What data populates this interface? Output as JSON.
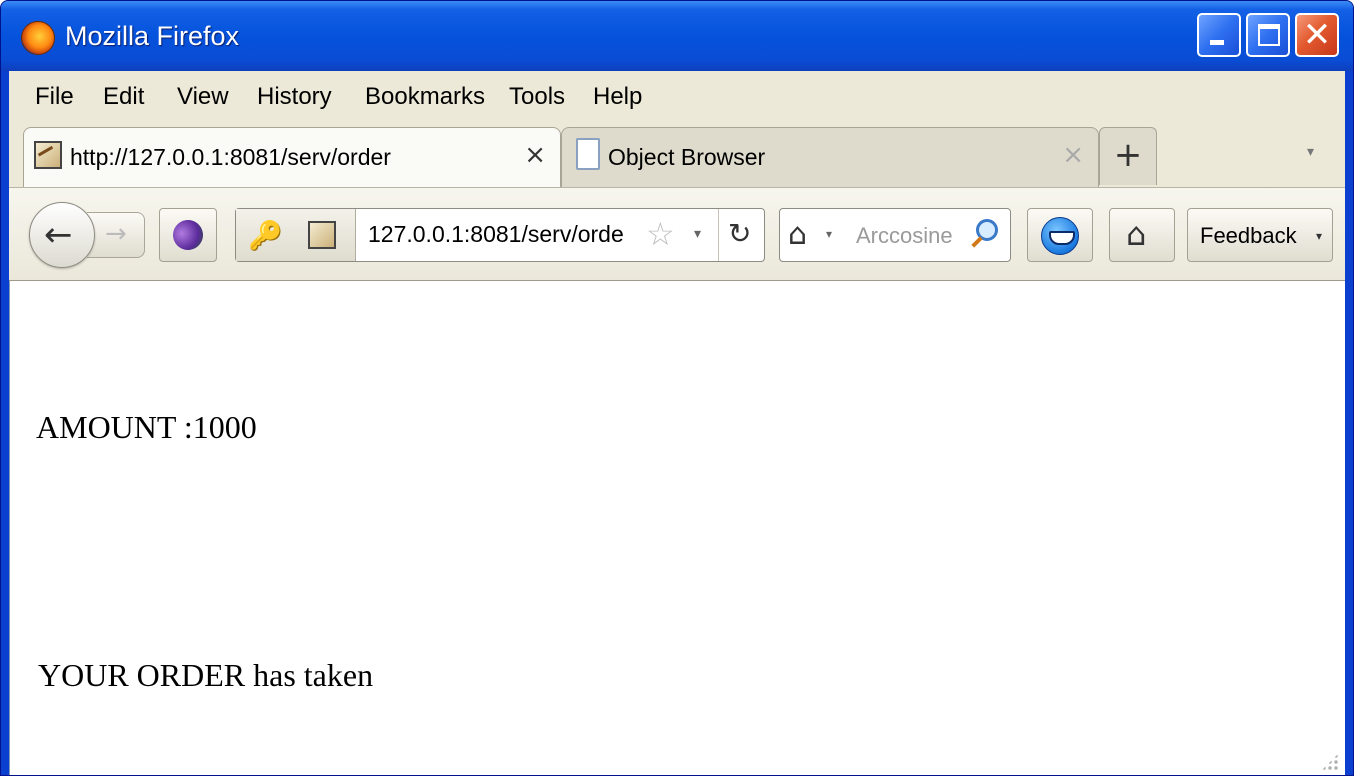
{
  "window": {
    "title": "Mozilla Firefox",
    "controls": {
      "minimize": "_",
      "maximize": "□",
      "close": "✕"
    }
  },
  "menubar": {
    "items": [
      "File",
      "Edit",
      "View",
      "History",
      "Bookmarks",
      "Tools",
      "Help"
    ]
  },
  "tabs": [
    {
      "label": "http://127.0.0.1:8081/serv/order",
      "active": true,
      "close": "×"
    },
    {
      "label": "Object Browser",
      "active": false,
      "close": "×"
    }
  ],
  "tabstrip": {
    "new_tab": "+",
    "list_arrow": "▾"
  },
  "navbar": {
    "back": "←",
    "forward": "→",
    "url": "127.0.0.1:8081/serv/orde",
    "star": "☆",
    "dropdown": "▾",
    "reload": "↻",
    "search_engine_icon": "home-icon",
    "search_placeholder": "Arccosine",
    "home": "⌂",
    "feedback_label": "Feedback"
  },
  "content": {
    "amount_line": "AMOUNT :1000",
    "order_line": "YOUR ORDER has taken"
  },
  "colors": {
    "titlebar": "#0552dc",
    "chrome": "#ece9d8",
    "close_button": "#e35a2f"
  }
}
